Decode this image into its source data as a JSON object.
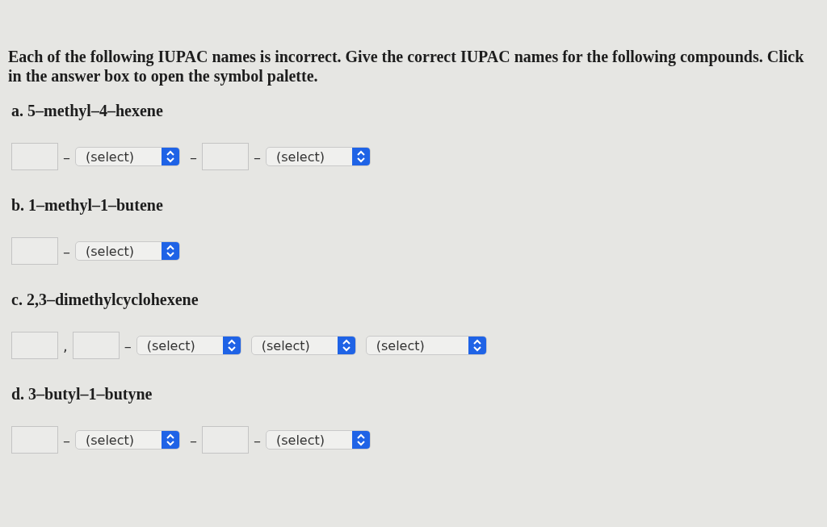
{
  "instructions": "Each of the following IUPAC names is incorrect. Give the correct IUPAC names for the following compounds. Click in the answer box to open the symbol palette.",
  "questions": [
    {
      "label": "a. 5–methyl–4–hexene",
      "parts": [
        {
          "kind": "box"
        },
        {
          "kind": "sep",
          "text": "–"
        },
        {
          "kind": "select",
          "text": "(select)"
        },
        {
          "kind": "sep",
          "text": "–"
        },
        {
          "kind": "box"
        },
        {
          "kind": "sep",
          "text": "–"
        },
        {
          "kind": "select",
          "text": "(select)"
        }
      ]
    },
    {
      "label": "b. 1–methyl–1–butene",
      "parts": [
        {
          "kind": "box"
        },
        {
          "kind": "sep",
          "text": "–"
        },
        {
          "kind": "select",
          "text": "(select)"
        }
      ]
    },
    {
      "label": "c. 2,3–dimethylcyclohexene",
      "parts": [
        {
          "kind": "box"
        },
        {
          "kind": "sep",
          "text": ","
        },
        {
          "kind": "box"
        },
        {
          "kind": "sep",
          "text": "–"
        },
        {
          "kind": "select",
          "text": "(select)"
        },
        {
          "kind": "select",
          "text": "(select)"
        },
        {
          "kind": "wideselect",
          "text": "(select)"
        }
      ]
    },
    {
      "label": "d. 3–butyl–1–butyne",
      "parts": [
        {
          "kind": "box"
        },
        {
          "kind": "sep",
          "text": "–"
        },
        {
          "kind": "select",
          "text": "(select)"
        },
        {
          "kind": "sep",
          "text": "–"
        },
        {
          "kind": "box"
        },
        {
          "kind": "sep",
          "text": "–"
        },
        {
          "kind": "select",
          "text": "(select)"
        }
      ]
    }
  ]
}
